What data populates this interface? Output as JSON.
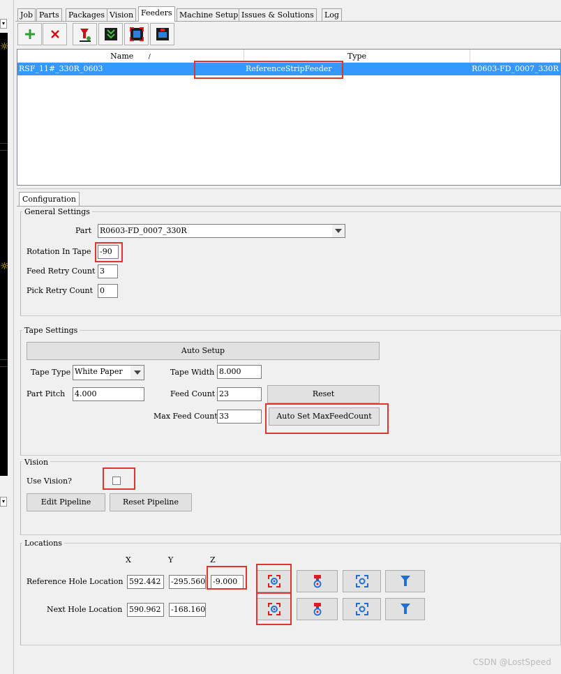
{
  "tabs": [
    "Job",
    "Parts",
    "Packages",
    "Vision",
    "Feeders",
    "Machine Setup",
    "Issues & Solutions",
    "Log"
  ],
  "toolbar": {
    "icons": [
      "add-feeder-icon",
      "delete-feeder-icon",
      "pick-icon",
      "feed-icon",
      "feed-capture-icon",
      "discard-icon"
    ]
  },
  "table": {
    "headers": [
      "Name",
      "Type",
      ""
    ],
    "sort_indicator": "/",
    "rows": [
      {
        "name": "RSF_11#_330R_0603",
        "type": "ReferenceStripFeeder",
        "part": "R0603-FD_0007_330R"
      }
    ]
  },
  "config_tab": "Configuration",
  "general": {
    "title": "General Settings",
    "part_label": "Part",
    "part_value": "R0603-FD_0007_330R",
    "rotation_label": "Rotation In Tape",
    "rotation_value": "-90",
    "feed_retry_label": "Feed Retry Count",
    "feed_retry_value": "3",
    "pick_retry_label": "Pick Retry Count",
    "pick_retry_value": "0"
  },
  "tape": {
    "title": "Tape Settings",
    "auto_setup": "Auto Setup",
    "tape_type_label": "Tape Type",
    "tape_type_value": "White Paper",
    "tape_width_label": "Tape Width",
    "tape_width_value": "8.000",
    "part_pitch_label": "Part Pitch",
    "part_pitch_value": "4.000",
    "feed_count_label": "Feed Count",
    "feed_count_value": "23",
    "reset": "Reset",
    "max_feed_label": "Max Feed Count",
    "max_feed_value": "33",
    "auto_set_max": "Auto Set MaxFeedCount"
  },
  "vision": {
    "title": "Vision",
    "use_vision_label": "Use Vision?",
    "use_vision_checked": false,
    "edit_pipeline": "Edit Pipeline",
    "reset_pipeline": "Reset Pipeline"
  },
  "locations": {
    "title": "Locations",
    "x_header": "X",
    "y_header": "Y",
    "z_header": "Z",
    "ref_label": "Reference Hole Location",
    "ref_x": "592.442",
    "ref_y": "-295.560",
    "ref_z": "-9.000",
    "next_label": "Next Hole Location",
    "next_x": "590.962",
    "next_y": "-168.160"
  },
  "watermark": "CSDN @LostSpeed",
  "colors": {
    "selection": "#3399ff",
    "highlight_box": "#e0352d",
    "add": "#2e9e2e",
    "delete": "#d01010"
  }
}
